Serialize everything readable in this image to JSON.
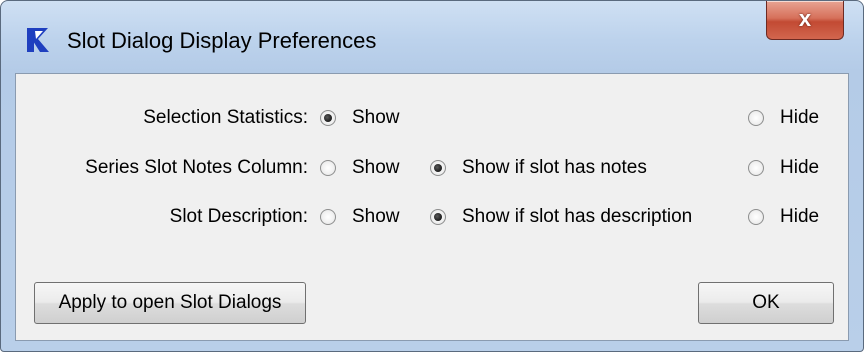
{
  "window": {
    "title": "Slot Dialog Display Preferences",
    "close_glyph": "x",
    "icon": "riverware-r-icon"
  },
  "rows": [
    {
      "label": "Selection Statistics:",
      "options": [
        {
          "label": "Show",
          "checked": true
        },
        {
          "label": "Hide",
          "checked": false
        }
      ]
    },
    {
      "label": "Series Slot Notes Column:",
      "options": [
        {
          "label": "Show",
          "checked": false
        },
        {
          "label": "Show if slot has notes",
          "checked": true
        },
        {
          "label": "Hide",
          "checked": false
        }
      ]
    },
    {
      "label": "Slot Description:",
      "options": [
        {
          "label": "Show",
          "checked": false
        },
        {
          "label": "Show if slot has description",
          "checked": true
        },
        {
          "label": "Hide",
          "checked": false
        }
      ]
    }
  ],
  "buttons": {
    "apply_label": "Apply to open Slot Dialogs",
    "ok_label": "OK"
  },
  "colors": {
    "title_accent": "#1f3fbf",
    "close_button": "#c24a33"
  }
}
